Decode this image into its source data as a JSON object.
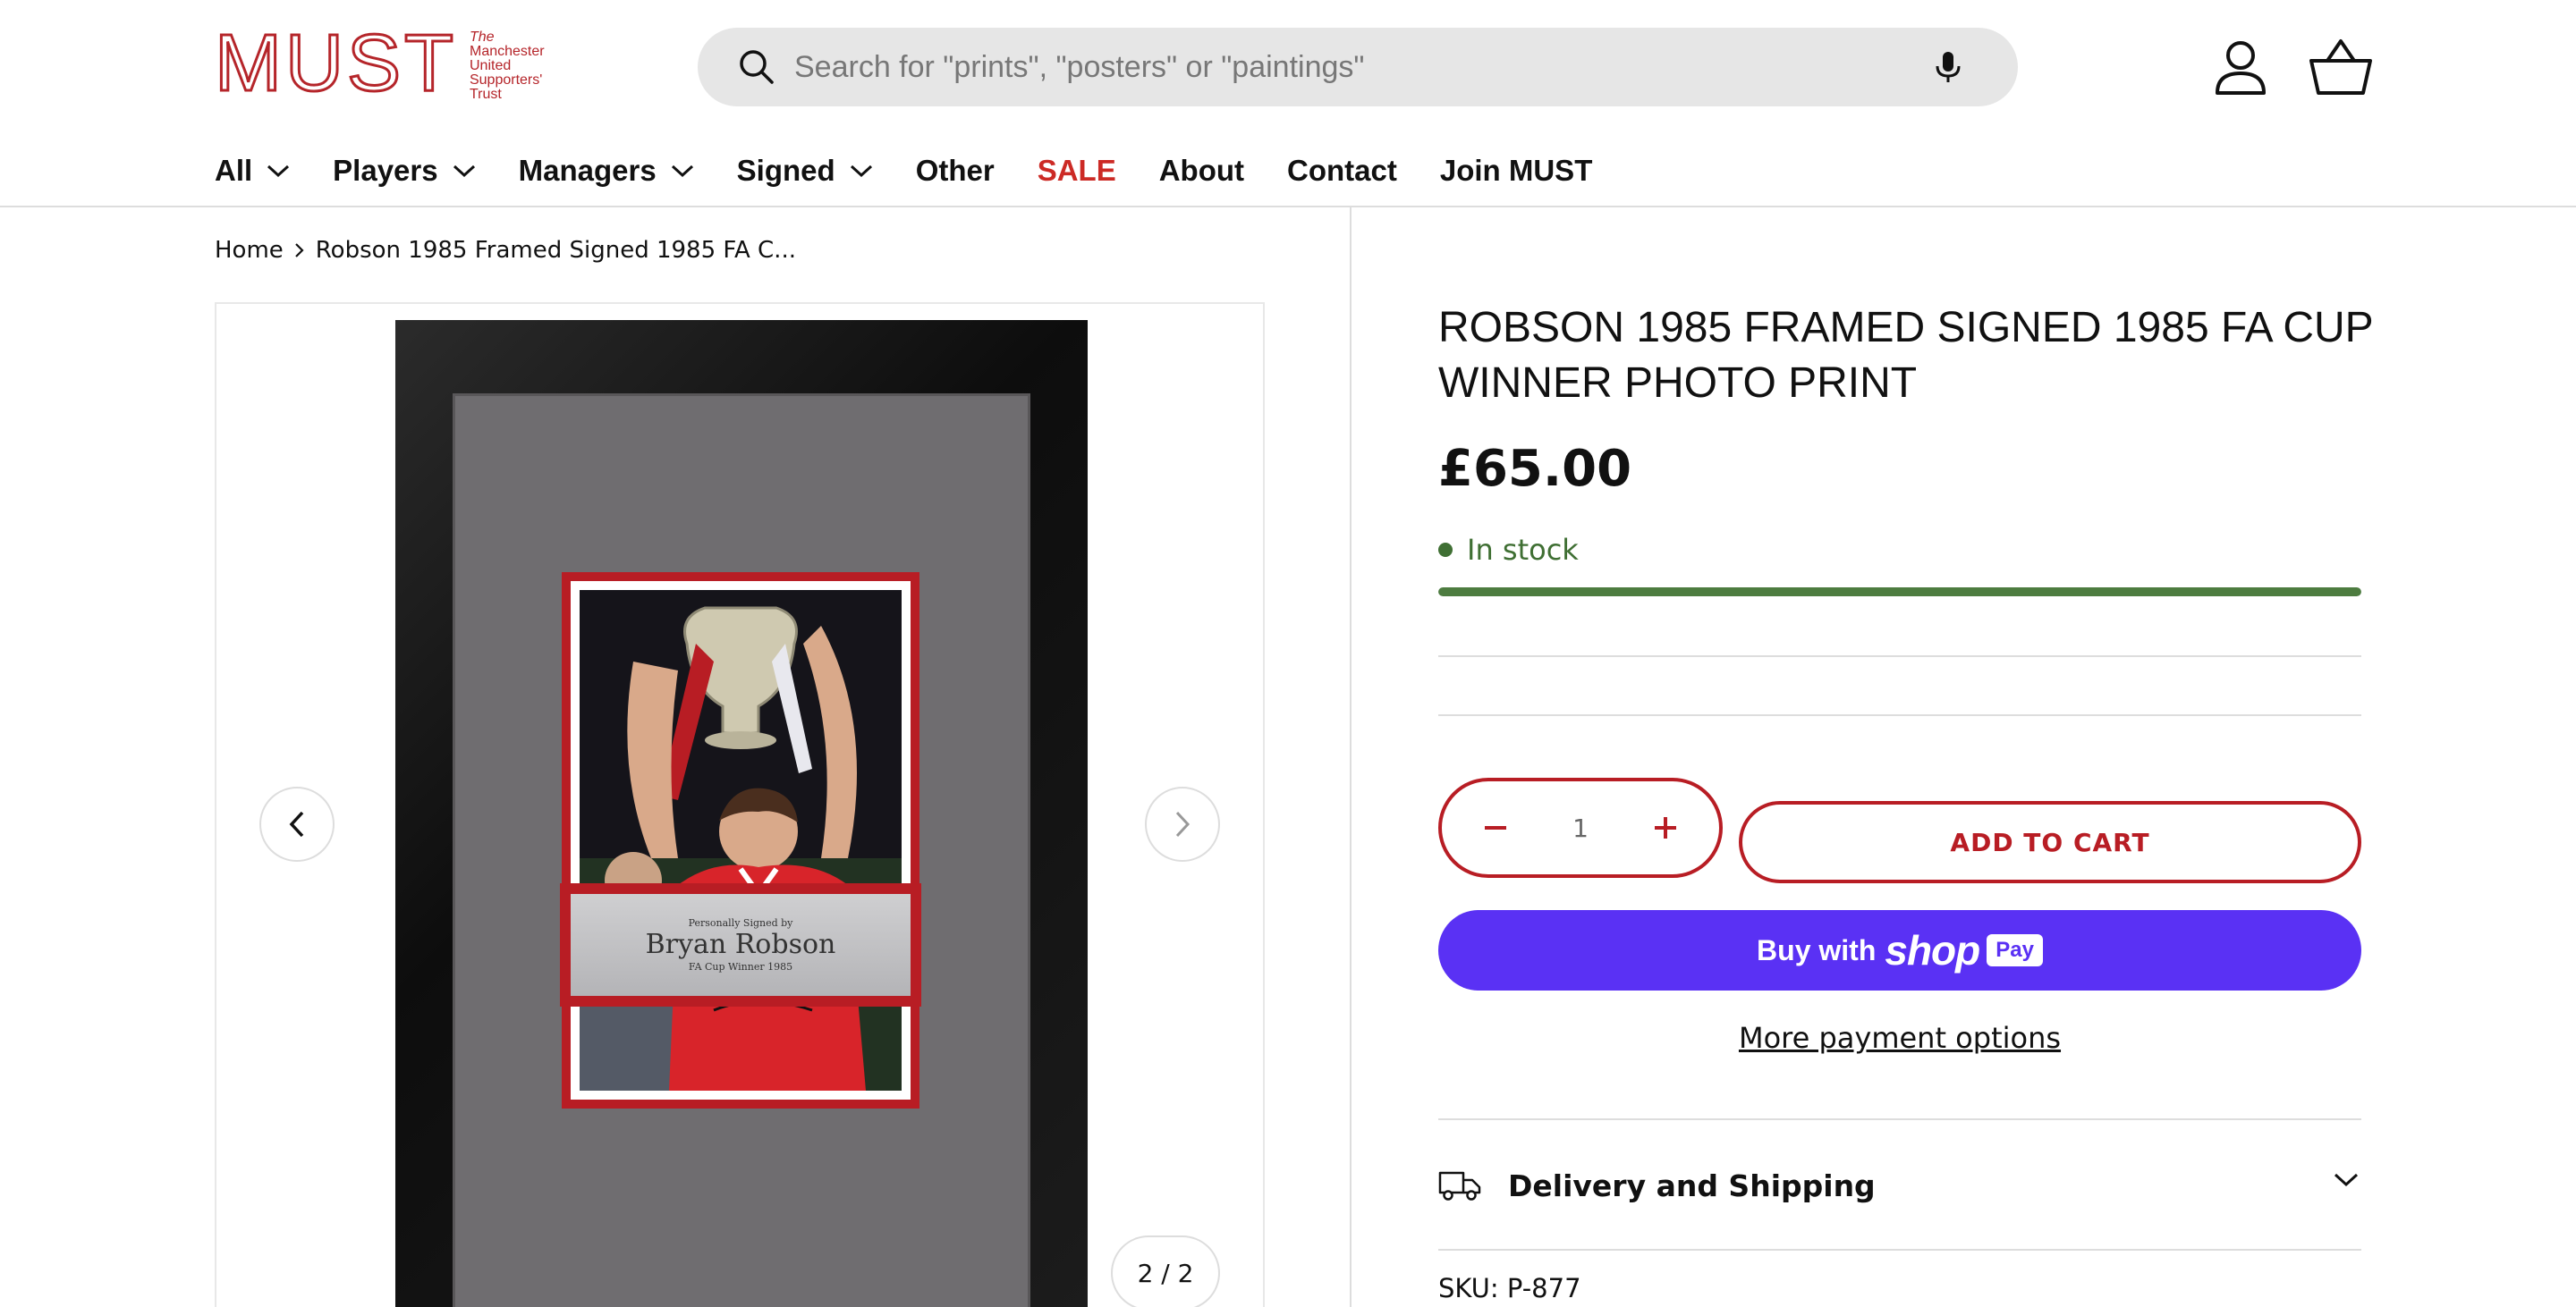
{
  "brand": {
    "wordmark": "MUST",
    "subtitle_lines": [
      "The",
      "Manchester",
      "United",
      "Supporters'",
      "Trust"
    ],
    "color": "#b5252a"
  },
  "search": {
    "placeholder": "Search for \"prints\", \"posters\" or \"paintings\""
  },
  "icons": {
    "search": "search-icon",
    "mic": "microphone-icon",
    "account": "account-icon",
    "cart": "basket-icon"
  },
  "nav": {
    "items": [
      {
        "label": "All",
        "dropdown": true
      },
      {
        "label": "Players",
        "dropdown": true
      },
      {
        "label": "Managers",
        "dropdown": true
      },
      {
        "label": "Signed",
        "dropdown": true
      },
      {
        "label": "Other",
        "dropdown": false
      },
      {
        "label": "SALE",
        "dropdown": false,
        "color": "#cc2a25"
      },
      {
        "label": "About",
        "dropdown": false
      },
      {
        "label": "Contact",
        "dropdown": false
      },
      {
        "label": "Join MUST",
        "dropdown": false
      }
    ]
  },
  "breadcrumb": {
    "home": "Home",
    "current": "Robson 1985 Framed Signed 1985 FA C..."
  },
  "gallery": {
    "counter": "2 / 2",
    "plaque": {
      "line1": "Personally Signed by",
      "name": "Bryan Robson",
      "line3": "FA Cup Winner 1985"
    }
  },
  "product": {
    "title": "Robson 1985 Framed Signed 1985 FA Cup Winner Photo Print",
    "price": "£65.00",
    "stock_label": "In stock",
    "stock_level": 1.0,
    "stock_color": "#3f6f33",
    "quantity": "1",
    "add_to_cart": "ADD TO CART",
    "buy_with": "Buy with",
    "shop_word": "shop",
    "pay_badge": "Pay",
    "shop_color": "#5a31f4",
    "more_payment": "More payment options",
    "delivery_label": "Delivery and Shipping",
    "sku": "SKU: P-877"
  },
  "accent": "#b81d24"
}
